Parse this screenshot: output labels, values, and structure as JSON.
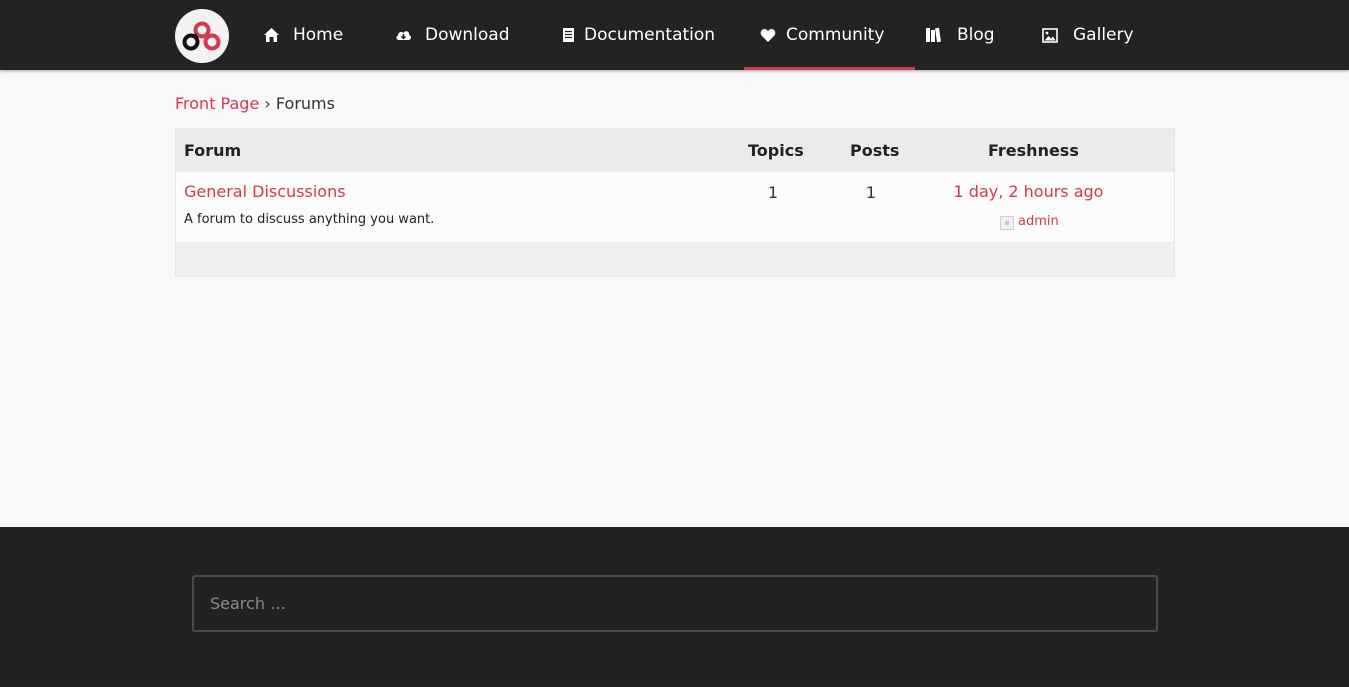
{
  "nav": {
    "items": [
      {
        "label": "Home",
        "icon": "home-icon"
      },
      {
        "label": "Download",
        "icon": "cloud-download-icon"
      },
      {
        "label": "Documentation",
        "icon": "document-icon"
      },
      {
        "label": "Community",
        "icon": "heart-icon",
        "active": true
      },
      {
        "label": "Blog",
        "icon": "books-icon"
      },
      {
        "label": "Gallery",
        "icon": "image-icon"
      }
    ],
    "accent": "#d33a4d"
  },
  "breadcrumb": {
    "home": "Front Page",
    "separator": "›",
    "current": "Forums"
  },
  "forum_table": {
    "headers": {
      "forum": "Forum",
      "topics": "Topics",
      "posts": "Posts",
      "freshness": "Freshness"
    },
    "rows": [
      {
        "title": "General Discussions",
        "description": "A forum to discuss anything you want.",
        "topics": "1",
        "posts": "1",
        "freshness": "1 day, 2 hours ago",
        "author": "admin"
      }
    ]
  },
  "footer": {
    "search_placeholder": "Search …"
  }
}
